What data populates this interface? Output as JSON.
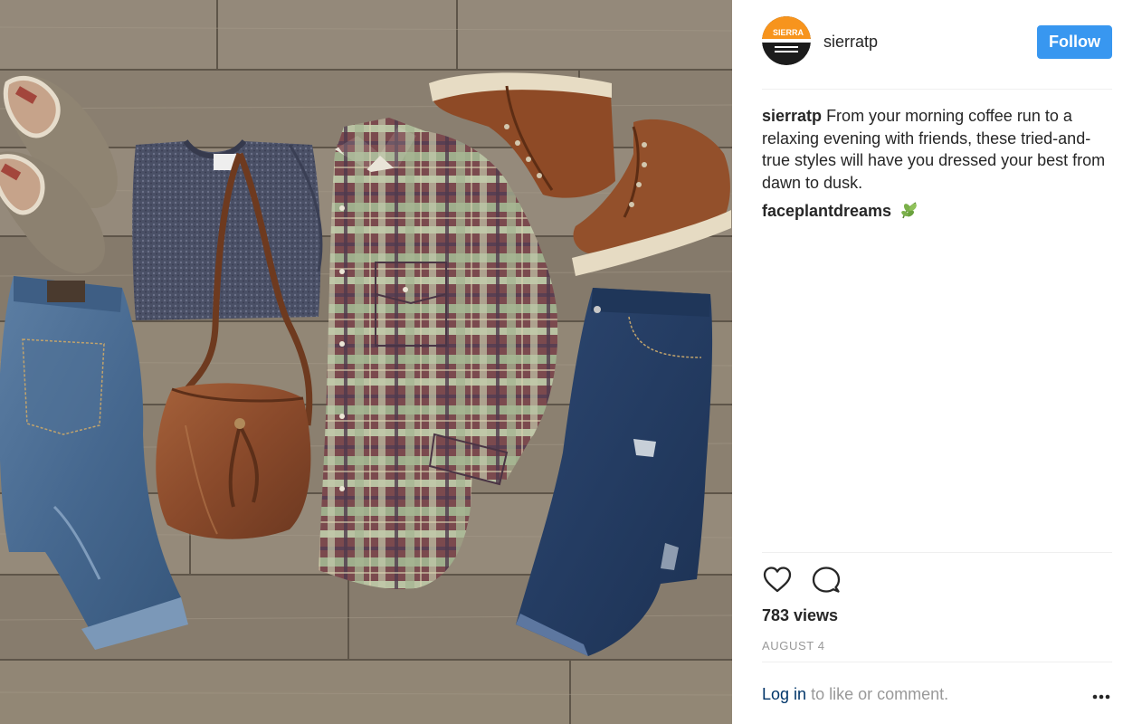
{
  "post": {
    "image_alt": "",
    "account": {
      "username": "sierratp",
      "avatar_icon": "sierra-logo-icon",
      "avatar_text": "SIERRA",
      "follow_label": "Follow"
    },
    "caption": {
      "author": "sierratp",
      "text": "From your morning coffee run to a relaxing evening with friends, these tried-and-true styles will have you dressed your best from dawn to dusk."
    },
    "comments": [
      {
        "author": "faceplantdreams",
        "emoji_icon": "herb-leaf-icon"
      }
    ],
    "actions": {
      "like_icon": "heart-icon",
      "comment_icon": "speech-bubble-icon"
    },
    "views": "783 views",
    "date": "AUGUST 4",
    "login": {
      "link_label": "Log in",
      "rest": "to like or comment."
    },
    "more_icon": "more-options-icon"
  },
  "colors": {
    "follow_button": "#3897f0",
    "link": "#003569",
    "muted": "#999999",
    "text": "#262626",
    "avatar_orange": "#f7941d"
  }
}
